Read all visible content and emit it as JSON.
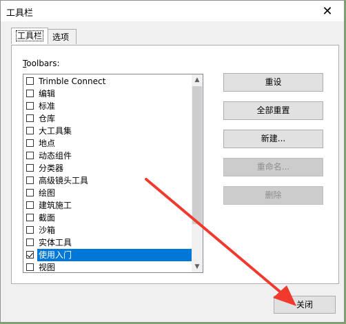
{
  "window": {
    "title": "工具栏",
    "close_glyph": "✕"
  },
  "tabs": [
    {
      "label": "工具栏",
      "active": true
    },
    {
      "label": "选项",
      "active": false
    }
  ],
  "toolbars_label": {
    "first_char": "T",
    "rest": "oolbars:"
  },
  "list": [
    {
      "label": "Trimble Connect",
      "checked": false,
      "selected": false
    },
    {
      "label": "编辑",
      "checked": false,
      "selected": false
    },
    {
      "label": "标准",
      "checked": false,
      "selected": false
    },
    {
      "label": "仓库",
      "checked": false,
      "selected": false
    },
    {
      "label": "大工具集",
      "checked": false,
      "selected": false
    },
    {
      "label": "地点",
      "checked": false,
      "selected": false
    },
    {
      "label": "动态组件",
      "checked": false,
      "selected": false
    },
    {
      "label": "分类器",
      "checked": false,
      "selected": false
    },
    {
      "label": "高级镜头工具",
      "checked": false,
      "selected": false
    },
    {
      "label": "绘图",
      "checked": false,
      "selected": false
    },
    {
      "label": "建筑施工",
      "checked": false,
      "selected": false
    },
    {
      "label": "截面",
      "checked": false,
      "selected": false
    },
    {
      "label": "沙箱",
      "checked": false,
      "selected": false
    },
    {
      "label": "实体工具",
      "checked": false,
      "selected": false
    },
    {
      "label": "使用入门",
      "checked": true,
      "selected": true
    },
    {
      "label": "视图",
      "checked": false,
      "selected": false
    }
  ],
  "scroll": {
    "up_glyph": "▲",
    "down_glyph": "▼"
  },
  "buttons": {
    "reset": "重设",
    "reset_all": "全部重置",
    "new": "新建...",
    "rename": "重命名...",
    "delete": "删除",
    "close": "关闭"
  },
  "colors": {
    "selection": "#0078d7",
    "annotation_arrow": "#f03a2e"
  }
}
